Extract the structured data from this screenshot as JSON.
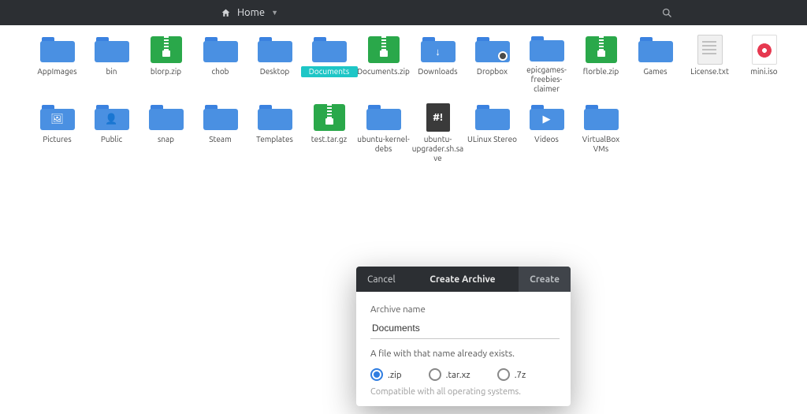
{
  "topbar": {
    "crumb_label": "Home"
  },
  "files": [
    {
      "name": "AppImages",
      "type": "folder"
    },
    {
      "name": "bin",
      "type": "folder"
    },
    {
      "name": "blorp.zip",
      "type": "archive"
    },
    {
      "name": "chob",
      "type": "folder"
    },
    {
      "name": "Desktop",
      "type": "folder"
    },
    {
      "name": "Documents",
      "type": "folder",
      "selected": true
    },
    {
      "name": "Documents.zip",
      "type": "archive"
    },
    {
      "name": "Downloads",
      "type": "folder",
      "glyph": "↓"
    },
    {
      "name": "Dropbox",
      "type": "folder",
      "variant": "dropbox"
    },
    {
      "name": "epicgames-freebies-claimer",
      "type": "folder"
    },
    {
      "name": "florble.zip",
      "type": "archive"
    },
    {
      "name": "Games",
      "type": "folder"
    },
    {
      "name": "License.txt",
      "type": "doc"
    },
    {
      "name": "mini.iso",
      "type": "iso"
    },
    {
      "name": "Pictures",
      "type": "folder",
      "glyph": "🖼"
    },
    {
      "name": "Public",
      "type": "folder",
      "glyph": "👤"
    },
    {
      "name": "snap",
      "type": "folder"
    },
    {
      "name": "Steam",
      "type": "folder"
    },
    {
      "name": "Templates",
      "type": "folder"
    },
    {
      "name": "test.tar.gz",
      "type": "archive"
    },
    {
      "name": "ubuntu-kernel-debs",
      "type": "folder"
    },
    {
      "name": "ubuntu-upgrader.sh.save",
      "type": "sh"
    },
    {
      "name": "ULinux Stereo",
      "type": "folder"
    },
    {
      "name": "Videos",
      "type": "folder",
      "glyph": "▶"
    },
    {
      "name": "VirtualBox VMs",
      "type": "folder"
    }
  ],
  "dialog": {
    "cancel_label": "Cancel",
    "title": "Create Archive",
    "create_label": "Create",
    "name_label": "Archive name",
    "name_value": "Documents",
    "warning": "A file with that name already exists.",
    "formats": [
      {
        "label": ".zip",
        "selected": true
      },
      {
        "label": ".tar.xz",
        "selected": false
      },
      {
        "label": ".7z",
        "selected": false
      }
    ],
    "compat_text": "Compatible with all operating systems."
  }
}
